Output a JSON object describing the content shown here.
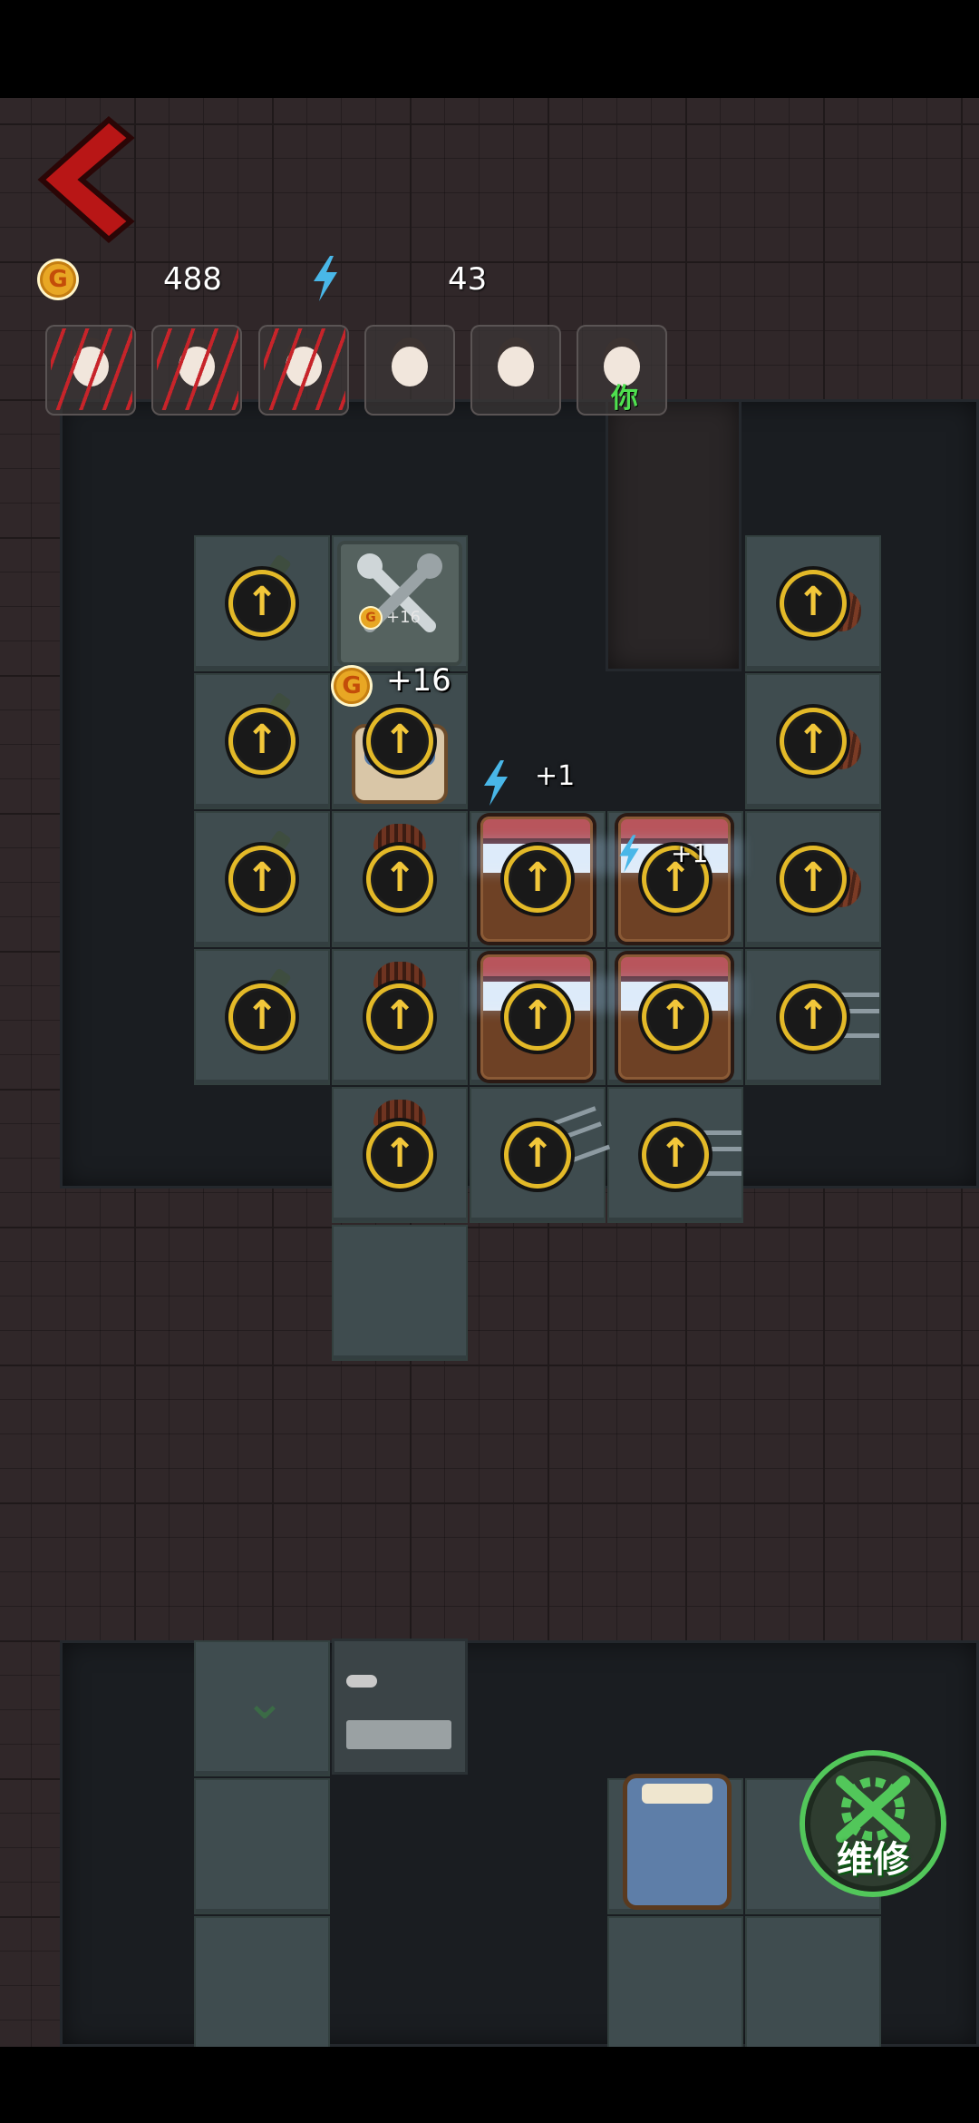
{
  "hud": {
    "gold": "488",
    "energy": "43",
    "gold_icon_letter": "G"
  },
  "players": [
    {
      "name": "player-1",
      "status": "attacked"
    },
    {
      "name": "player-2",
      "status": "attacked"
    },
    {
      "name": "player-3",
      "status": "attacked"
    },
    {
      "name": "player-4",
      "status": "normal"
    },
    {
      "name": "player-5",
      "status": "normal"
    },
    {
      "name": "player-6",
      "status": "you",
      "tag": "你"
    }
  ],
  "popups": {
    "gold_gain": "+16",
    "gold_gain_small": "+16",
    "energy_gain": "+1",
    "energy_gain_small": "+1"
  },
  "repair_button": {
    "label": "维修",
    "accent": "#52c75a"
  },
  "colors": {
    "gold": "#e3b928",
    "claw": "#c7242a",
    "you_tag": "#4fe04f"
  }
}
